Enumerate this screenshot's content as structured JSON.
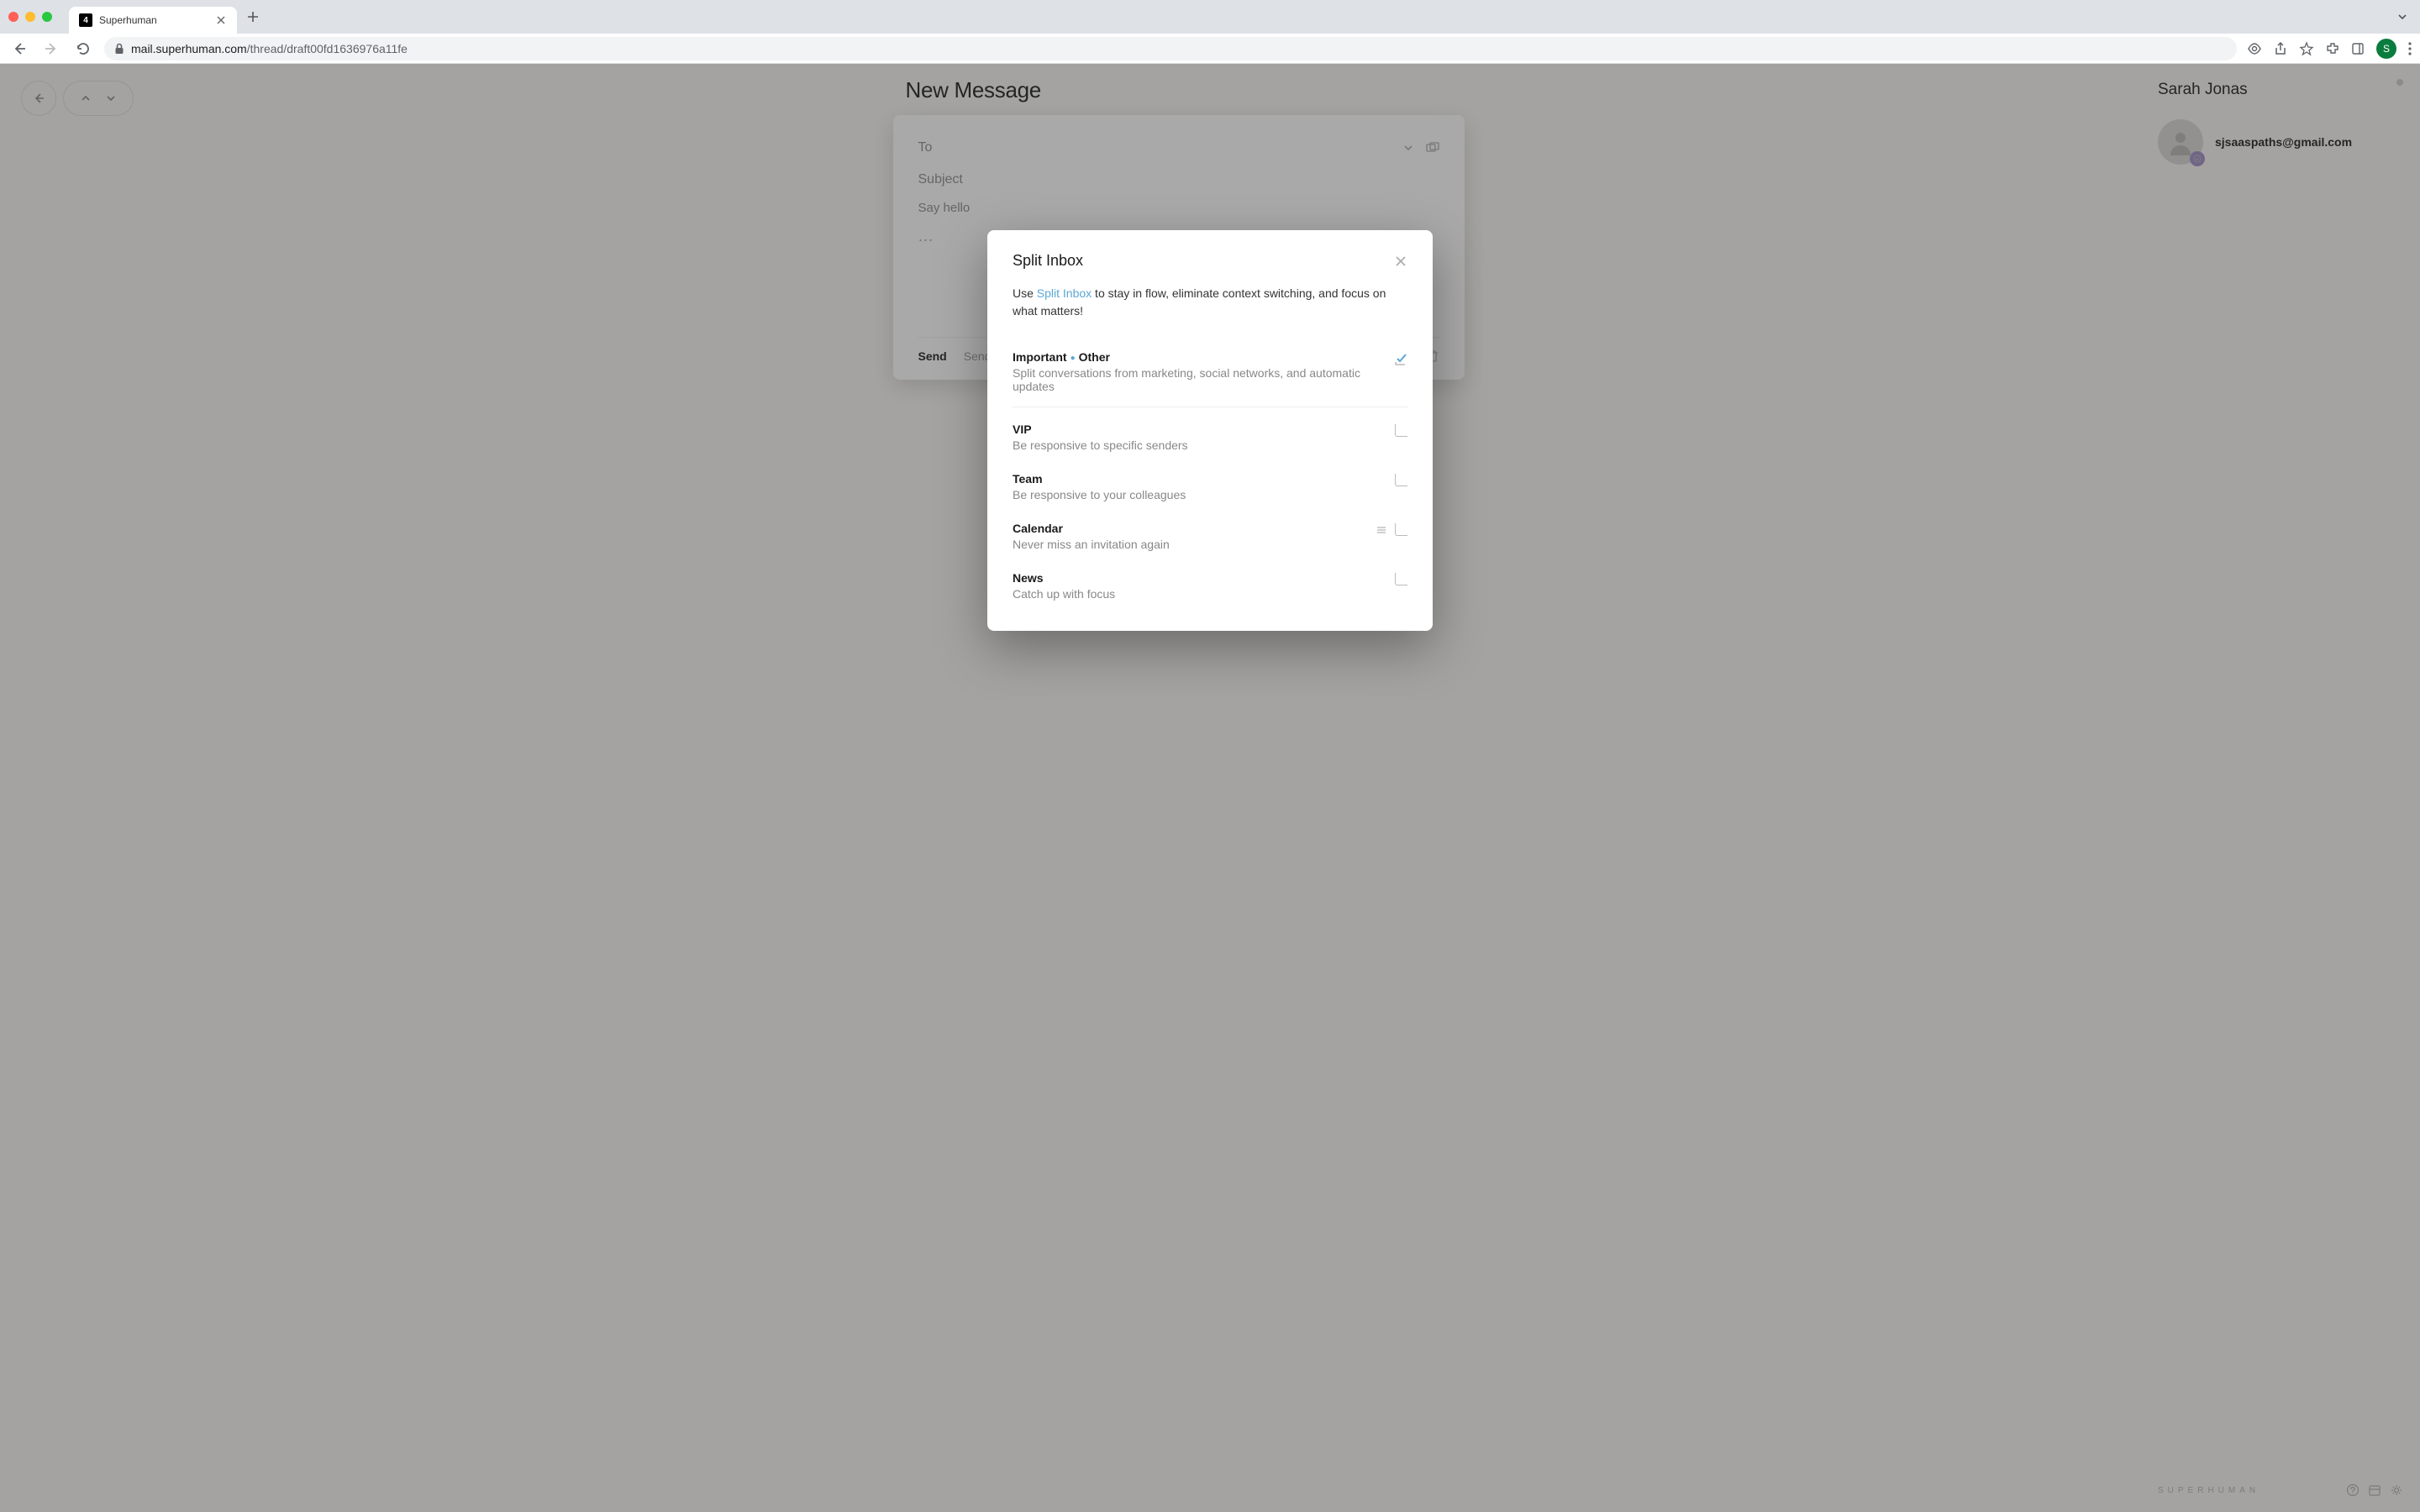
{
  "browser": {
    "tab_badge": "4",
    "tab_title": "Superhuman",
    "url_host": "mail.superhuman.com",
    "url_path": "/thread/draft00fd1636976a11fe",
    "avatar_initial": "S"
  },
  "compose": {
    "header": "New Message",
    "to_label": "To",
    "subject_label": "Subject",
    "body_placeholder": "Say hello",
    "ellipsis": "⋯",
    "send": "Send",
    "send_later": "Send later"
  },
  "contact": {
    "name": "Sarah Jonas",
    "email": "sjsaaspaths@gmail.com"
  },
  "brand": "SUPERHUMAN",
  "modal": {
    "title": "Split Inbox",
    "desc_prefix": "Use ",
    "desc_link": "Split Inbox",
    "desc_suffix": " to stay in flow, eliminate context switching, and focus on what matters!",
    "items": [
      {
        "name_a": "Important",
        "name_b": "Other",
        "sub": "Split conversations from marketing, social networks, and automatic updates",
        "checked": true
      },
      {
        "name": "VIP",
        "sub": "Be responsive to specific senders"
      },
      {
        "name": "Team",
        "sub": "Be responsive to your colleagues"
      },
      {
        "name": "Calendar",
        "sub": "Never miss an invitation again",
        "drag": true
      },
      {
        "name": "News",
        "sub": "Catch up with focus"
      }
    ]
  }
}
